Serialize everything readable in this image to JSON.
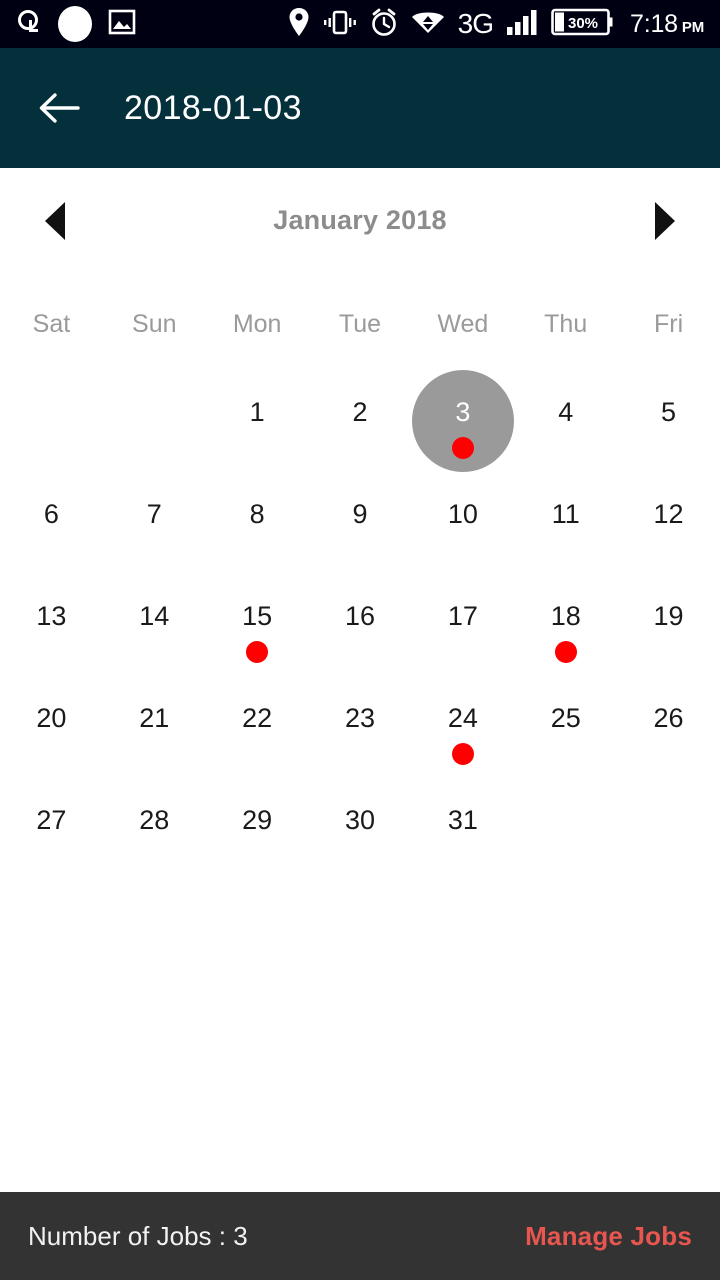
{
  "status_bar": {
    "background": "#000013",
    "time": "7:18",
    "meridiem": "PM",
    "battery_percent": "30%",
    "network_type": "3G",
    "left_icons": [
      "app-notification-icon",
      "white-circle-icon",
      "gallery-image-icon"
    ],
    "right_icons": [
      "location-pin-icon",
      "vibrate-icon",
      "alarm-clock-icon",
      "wifi-download-icon",
      "signal-bars-icon",
      "battery-icon"
    ]
  },
  "app_bar": {
    "background": "#04303c",
    "title": "2018-01-03",
    "back_icon": "back-arrow-icon"
  },
  "calendar": {
    "month_label": "January 2018",
    "prev_icon": "chevron-left-icon",
    "next_icon": "chevron-right-icon",
    "weekdays": [
      "Sat",
      "Sun",
      "Mon",
      "Tue",
      "Wed",
      "Thu",
      "Fri"
    ],
    "selected_day": 3,
    "event_days": [
      3,
      15,
      18,
      24
    ],
    "selected_circle_color": "#9a9a9a",
    "event_dot_color": "#ff0000",
    "cells": [
      {
        "label": "",
        "empty": true
      },
      {
        "label": "",
        "empty": true
      },
      {
        "label": "1",
        "empty": false
      },
      {
        "label": "2",
        "empty": false
      },
      {
        "label": "3",
        "empty": false,
        "selected": true,
        "event": true
      },
      {
        "label": "4",
        "empty": false
      },
      {
        "label": "5",
        "empty": false
      },
      {
        "label": "6",
        "empty": false
      },
      {
        "label": "7",
        "empty": false
      },
      {
        "label": "8",
        "empty": false
      },
      {
        "label": "9",
        "empty": false
      },
      {
        "label": "10",
        "empty": false
      },
      {
        "label": "11",
        "empty": false
      },
      {
        "label": "12",
        "empty": false
      },
      {
        "label": "13",
        "empty": false
      },
      {
        "label": "14",
        "empty": false
      },
      {
        "label": "15",
        "empty": false,
        "event": true
      },
      {
        "label": "16",
        "empty": false
      },
      {
        "label": "17",
        "empty": false
      },
      {
        "label": "18",
        "empty": false,
        "event": true
      },
      {
        "label": "19",
        "empty": false
      },
      {
        "label": "20",
        "empty": false
      },
      {
        "label": "21",
        "empty": false
      },
      {
        "label": "22",
        "empty": false
      },
      {
        "label": "23",
        "empty": false
      },
      {
        "label": "24",
        "empty": false,
        "event": true
      },
      {
        "label": "25",
        "empty": false
      },
      {
        "label": "26",
        "empty": false
      },
      {
        "label": "27",
        "empty": false
      },
      {
        "label": "28",
        "empty": false
      },
      {
        "label": "29",
        "empty": false
      },
      {
        "label": "30",
        "empty": false
      },
      {
        "label": "31",
        "empty": false
      },
      {
        "label": "",
        "empty": true
      },
      {
        "label": "",
        "empty": true
      }
    ]
  },
  "bottom_bar": {
    "background": "#333333",
    "jobs_label": "Number of Jobs : 3",
    "manage_label": "Manage Jobs",
    "manage_color": "#e8564f"
  }
}
